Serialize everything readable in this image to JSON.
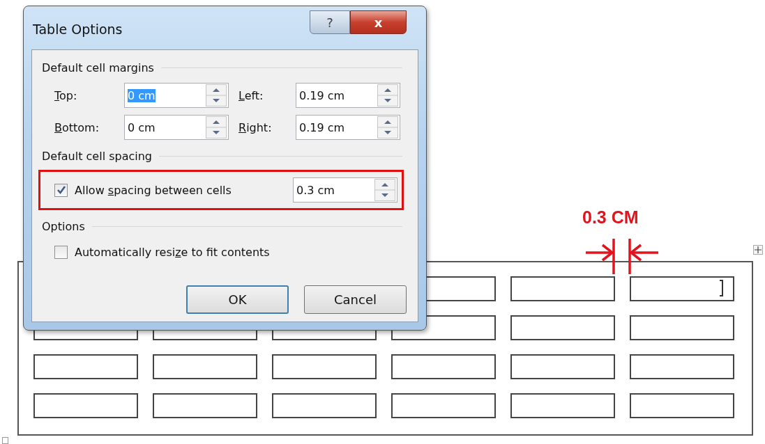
{
  "dialog": {
    "title": "Table Options",
    "help_button": "?",
    "close_button": "x",
    "sections": [
      {
        "kind": "margins",
        "heading": "Default cell margins",
        "fields": [
          {
            "label": {
              "key": "T",
              "post": "op:"
            },
            "value": "0 cm",
            "text_selected": true
          },
          {
            "label": {
              "key": "L",
              "post": "eft:"
            },
            "value": "0.19 cm",
            "text_selected": false
          },
          {
            "label": {
              "key": "B",
              "post": "ottom:"
            },
            "value": "0 cm",
            "text_selected": false
          },
          {
            "label": {
              "key": "R",
              "post": "ight:"
            },
            "value": "0.19 cm",
            "text_selected": false
          }
        ]
      },
      {
        "kind": "spacing",
        "heading": "Default cell spacing",
        "highlighted": true,
        "checkbox": {
          "label": {
            "pre": "Allow ",
            "key": "s",
            "post": "pacing between cells"
          },
          "checked": true
        },
        "field": {
          "value": "0.3 cm",
          "text_selected": false
        }
      },
      {
        "kind": "options",
        "heading": "Options",
        "checkbox": {
          "label": {
            "pre": "Automatically resi",
            "key": "z",
            "post": "e to fit contents"
          },
          "checked": false
        }
      }
    ],
    "buttons": [
      {
        "label": "OK",
        "default": true
      },
      {
        "label": "Cancel",
        "default": false
      }
    ]
  },
  "annotation": {
    "text": "0.3 CM"
  },
  "table": {
    "rows": [
      {
        "cells": [
          {
            "kind": "empty"
          },
          {
            "kind": "empty"
          },
          {
            "kind": "empty",
            "cursor": true
          }
        ]
      },
      {
        "cells": [
          {
            "kind": "empty"
          },
          {
            "kind": "empty"
          },
          {
            "kind": "empty"
          },
          {
            "kind": "empty"
          },
          {
            "kind": "empty"
          },
          {
            "kind": "empty"
          }
        ]
      },
      {
        "cells": [
          {
            "kind": "empty"
          },
          {
            "kind": "empty"
          },
          {
            "kind": "empty"
          },
          {
            "kind": "empty"
          },
          {
            "kind": "empty"
          },
          {
            "kind": "empty"
          }
        ]
      },
      {
        "cells": [
          {
            "kind": "empty"
          },
          {
            "kind": "empty"
          },
          {
            "kind": "empty"
          },
          {
            "kind": "empty"
          },
          {
            "kind": "empty"
          },
          {
            "kind": "empty"
          }
        ]
      }
    ]
  }
}
